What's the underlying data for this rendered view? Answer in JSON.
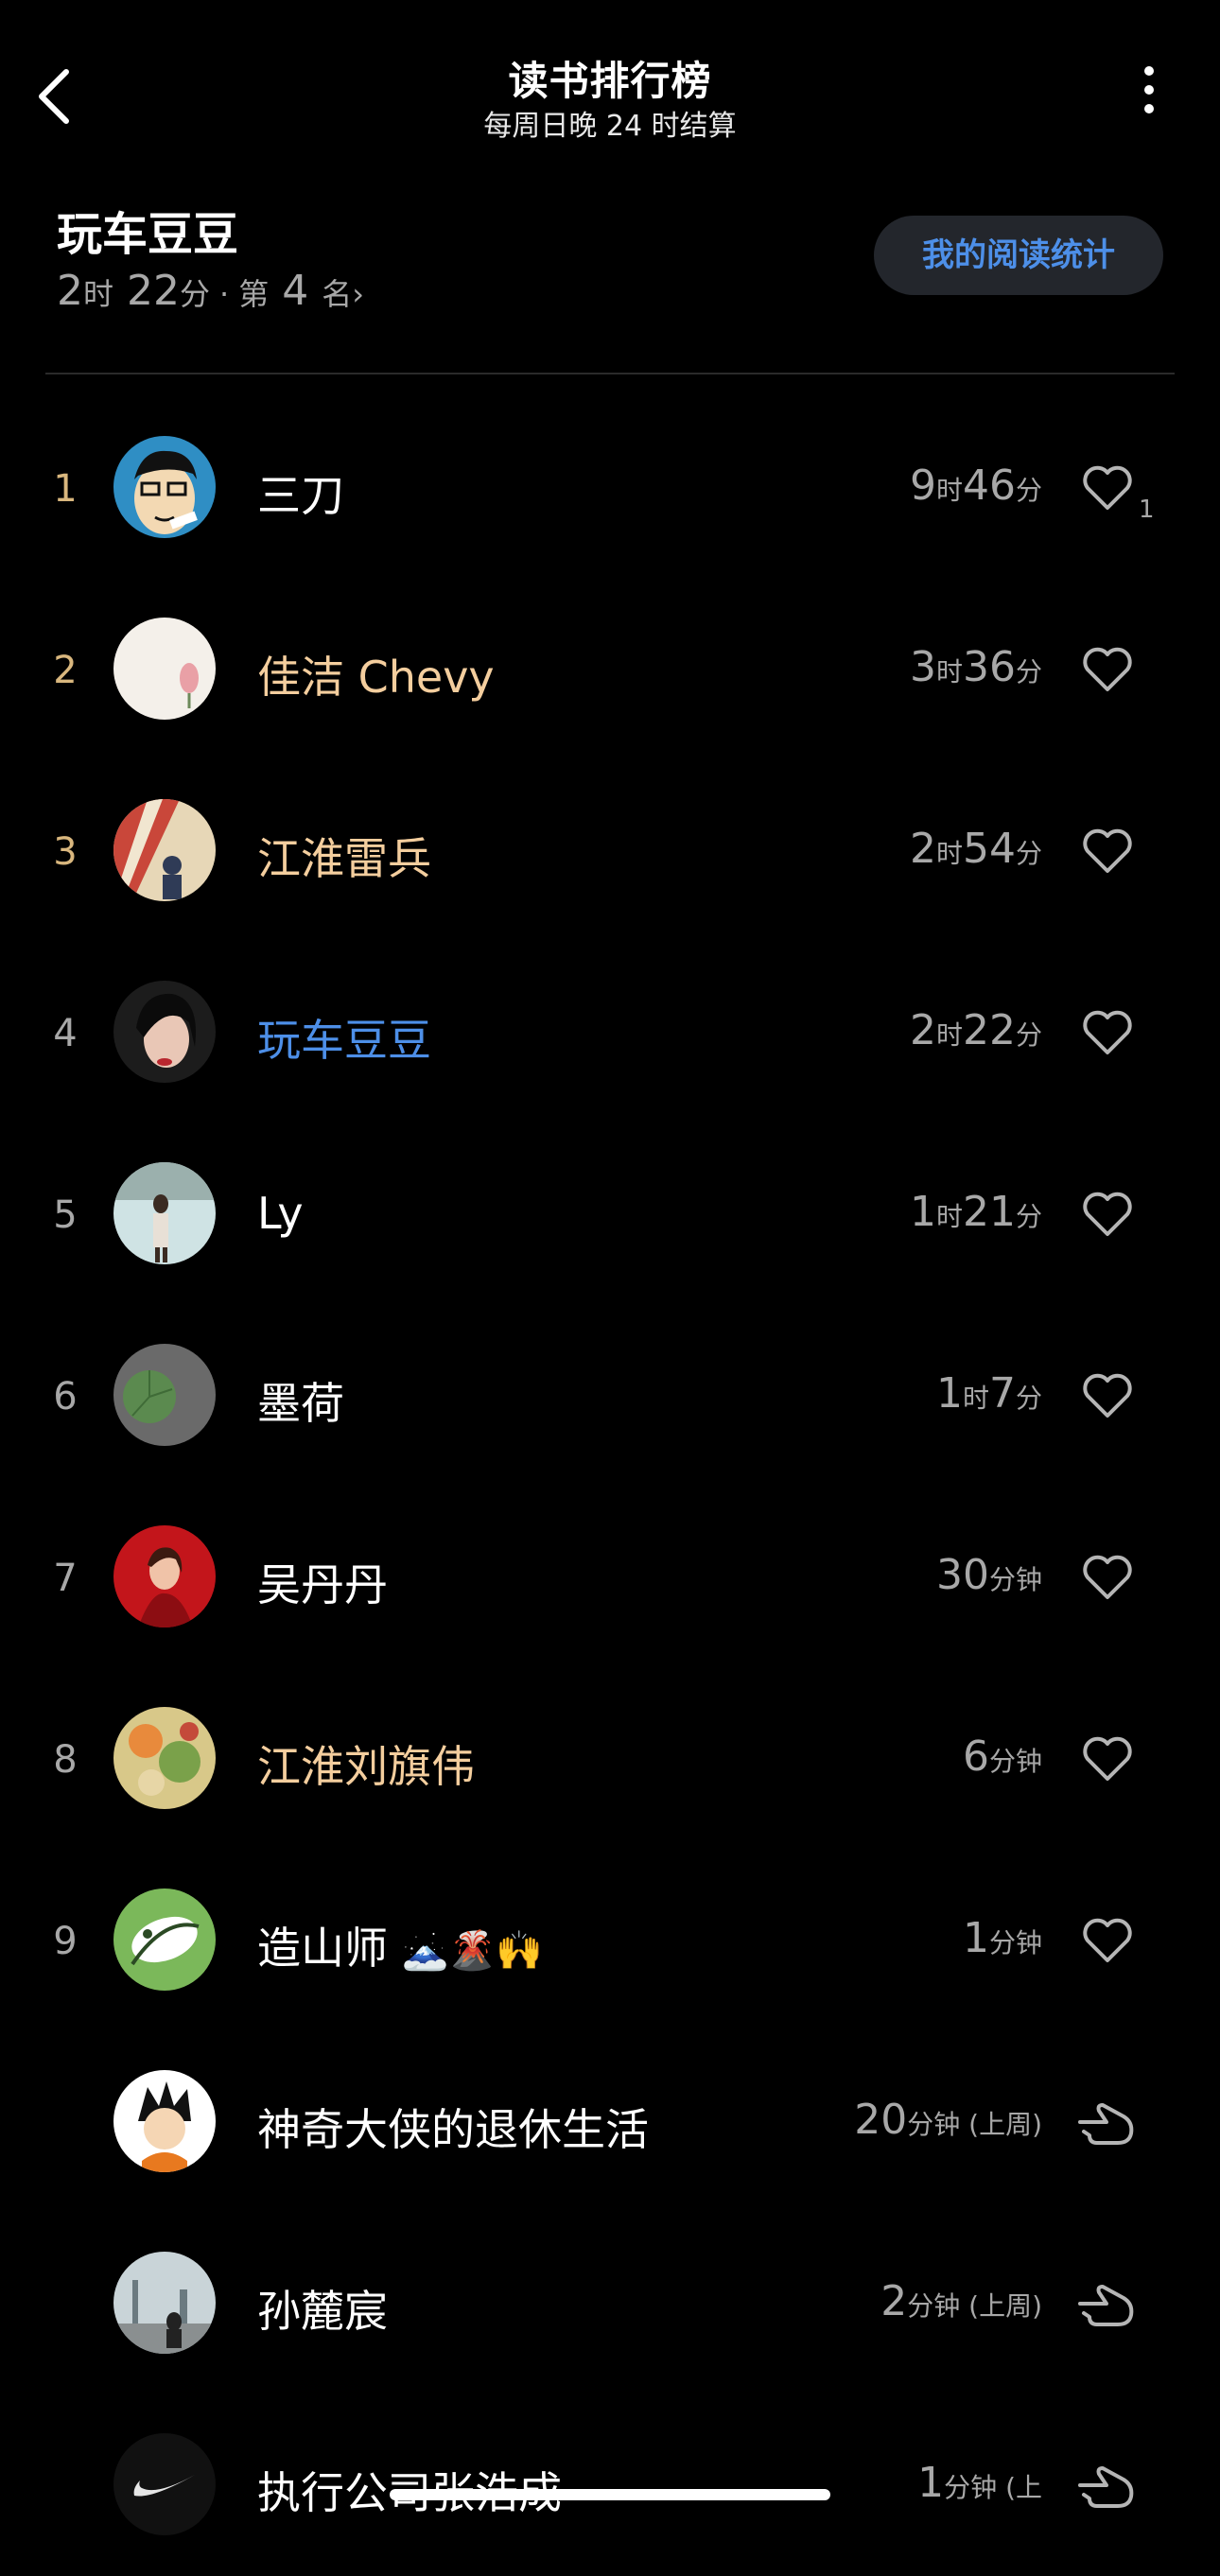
{
  "header": {
    "title": "读书排行榜",
    "subtitle": "每周日晚 24 时结算"
  },
  "me": {
    "name": "玩车豆豆",
    "hours": "2",
    "hour_unit": "时",
    "minutes": "22",
    "minute_unit": "分",
    "separator": "·",
    "rank_label": "第",
    "rank": "4",
    "rank_suffix": "名›",
    "stats_button": "我的阅读统计"
  },
  "rankings": [
    {
      "rank": "1",
      "name": "三刀",
      "h": "9",
      "hu": "时",
      "m": "46",
      "mu": "分",
      "like_count": "1"
    },
    {
      "rank": "2",
      "name": "佳洁 Chevy",
      "h": "3",
      "hu": "时",
      "m": "36",
      "mu": "分"
    },
    {
      "rank": "3",
      "name": "江淮雷兵",
      "h": "2",
      "hu": "时",
      "m": "54",
      "mu": "分"
    },
    {
      "rank": "4",
      "name": "玩车豆豆",
      "h": "2",
      "hu": "时",
      "m": "22",
      "mu": "分"
    },
    {
      "rank": "5",
      "name": "Ly",
      "h": "1",
      "hu": "时",
      "m": "21",
      "mu": "分"
    },
    {
      "rank": "6",
      "name": "墨荷",
      "h": "1",
      "hu": "时",
      "m": "7",
      "mu": "分"
    },
    {
      "rank": "7",
      "name": "吴丹丹",
      "v": "30",
      "u": "分钟"
    },
    {
      "rank": "8",
      "name": "江淮刘旗伟",
      "v": "6",
      "u": "分钟"
    },
    {
      "rank": "9",
      "name": "造山师",
      "emoji": "🗻🌋🙌",
      "v": "1",
      "u": "分钟"
    },
    {
      "name": "神奇大侠的退休生活",
      "v": "20",
      "u": "分钟 (上周)"
    },
    {
      "name": "孙麓宸",
      "v": "2",
      "u": "分钟 (上周)"
    },
    {
      "name": "执行公司张浩成",
      "v": "1",
      "u": "分钟 (上"
    }
  ],
  "colors": {
    "background": "#000000",
    "gold_rank": "#d9b77e",
    "gold_name": "#f4ce9e",
    "accent_blue": "#4d8fe8",
    "muted": "#a8a8a8"
  },
  "icons": {
    "back": "chevron-left-icon",
    "more": "vertical-ellipsis-icon",
    "like": "heart-outline-icon",
    "poke": "pointing-hand-icon"
  }
}
